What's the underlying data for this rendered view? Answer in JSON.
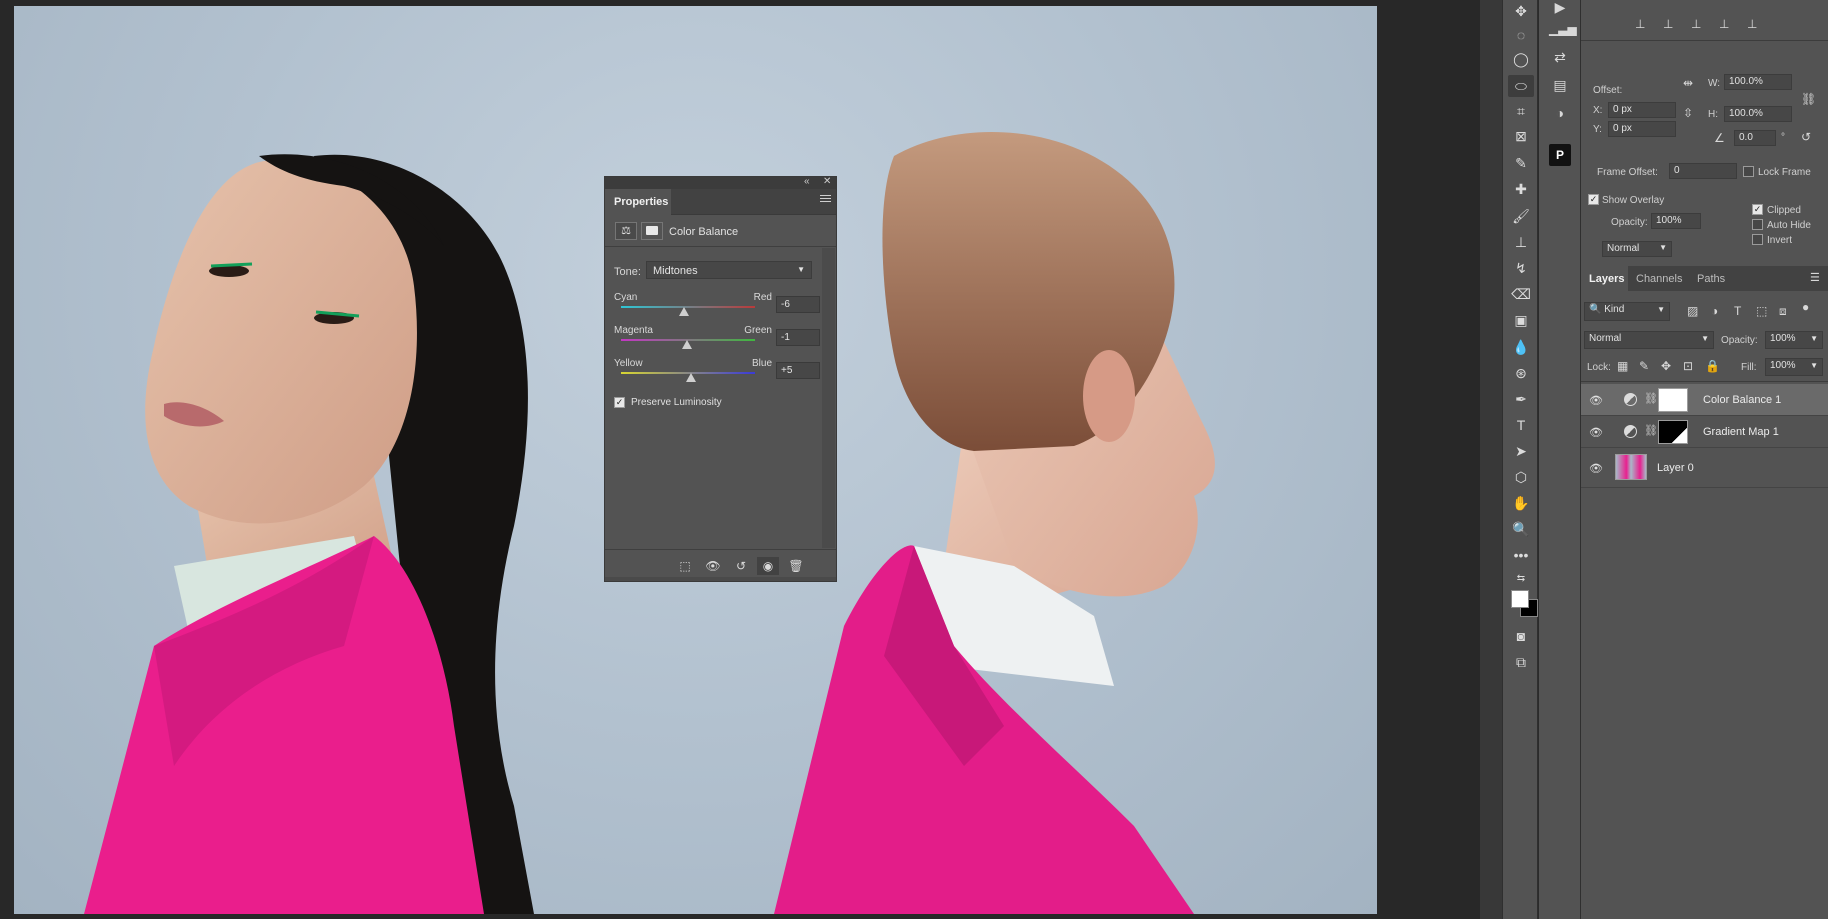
{
  "properties_panel": {
    "tab": "Properties",
    "title": "Color Balance",
    "tone_label": "Tone:",
    "tone_value": "Midtones",
    "sliders": [
      {
        "left": "Cyan",
        "right": "Red",
        "value": "-6",
        "level": 0.47,
        "gradient": [
          "#2ec7d6",
          "#b93a3a"
        ]
      },
      {
        "left": "Magenta",
        "right": "Green",
        "value": "-1",
        "level": 0.495,
        "gradient": [
          "#c337c3",
          "#3fb83f"
        ]
      },
      {
        "left": "Yellow",
        "right": "Blue",
        "value": "+5",
        "level": 0.525,
        "gradient": [
          "#d8d632",
          "#3a3ad8"
        ]
      }
    ],
    "preserve_luminosity": "Preserve Luminosity",
    "preserve_checked": true
  },
  "transform_panel": {
    "offset_label": "Offset:",
    "x_label": "X:",
    "x_value": "0 px",
    "y_label": "Y:",
    "y_value": "0 px",
    "w_label": "W:",
    "w_value": "100.0%",
    "h_label": "H:",
    "h_value": "100.0%",
    "angle_value": "0.0",
    "degree": "°",
    "frame_offset_label": "Frame Offset:",
    "frame_offset_value": "0",
    "lock_frame": "Lock Frame",
    "show_overlay": "Show Overlay",
    "opacity_label": "Opacity:",
    "opacity_value": "100%",
    "blend_value": "Normal",
    "clipped": "Clipped",
    "auto_hide": "Auto Hide",
    "invert": "Invert"
  },
  "layers_panel": {
    "tabs": [
      "Layers",
      "Channels",
      "Paths"
    ],
    "filter": "Kind",
    "blend_mode": "Normal",
    "opacity_label": "Opacity:",
    "opacity_value": "100%",
    "lock_label": "Lock:",
    "fill_label": "Fill:",
    "fill_value": "100%",
    "layers": [
      {
        "name": "Color Balance 1",
        "selected": true
      },
      {
        "name": "Gradient Map 1",
        "selected": false
      },
      {
        "name": "Layer 0",
        "selected": false
      }
    ]
  },
  "colors": {
    "foreground": "#ffffff",
    "background": "#000000",
    "accent_pink": "#e8208f"
  }
}
